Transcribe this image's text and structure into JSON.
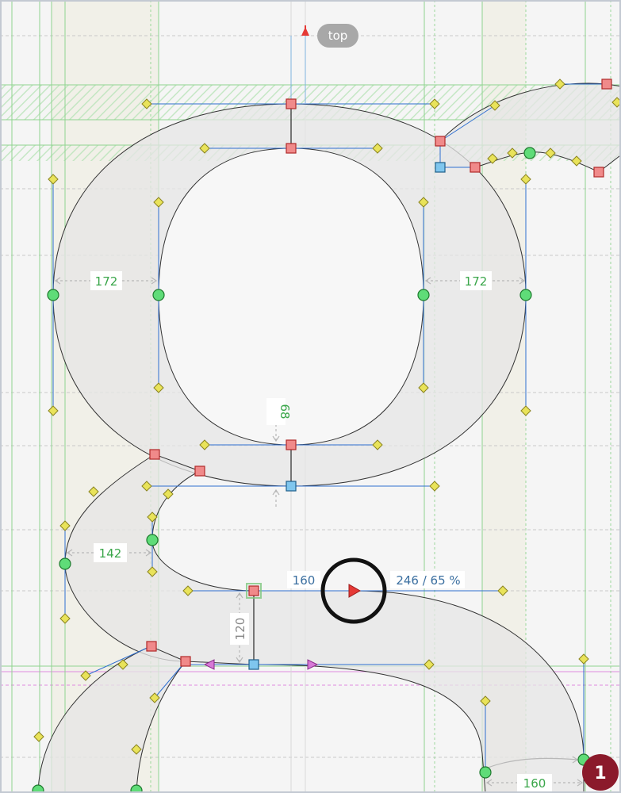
{
  "guide_label": "top",
  "measurements": {
    "left_bowl_width": "172",
    "right_bowl_width": "172",
    "bowl_gap": "68",
    "link_width": "142",
    "handle_length": "160",
    "curve_tension": "246 / 65 %",
    "ear_thickness": "120",
    "tail_width": "160"
  },
  "badge_count": "1",
  "colors": {
    "accent_red": "#e53935",
    "badge": "#8b1a2b",
    "guide_green": "#8fd48f",
    "guide_pink": "#e08ae0"
  }
}
